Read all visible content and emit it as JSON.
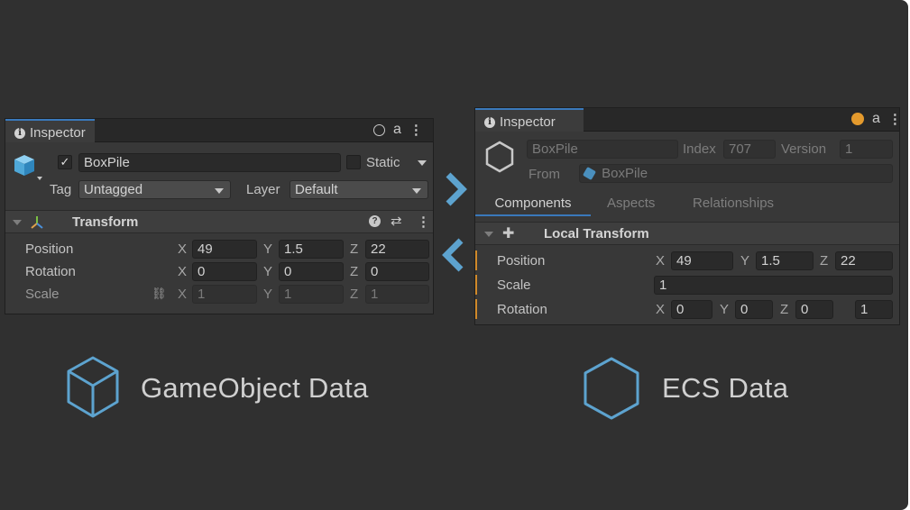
{
  "left_inspector": {
    "tab_label": "Inspector",
    "object_name": "BoxPile",
    "static_label": "Static",
    "tag_label": "Tag",
    "tag_value": "Untagged",
    "layer_label": "Layer",
    "layer_value": "Default",
    "transform_title": "Transform",
    "rows": [
      {
        "label": "Position",
        "x": "49",
        "y": "1.5",
        "z": "22"
      },
      {
        "label": "Rotation",
        "x": "0",
        "y": "0",
        "z": "0"
      },
      {
        "label": "Scale",
        "x": "1",
        "y": "1",
        "z": "1"
      }
    ]
  },
  "right_inspector": {
    "tab_label": "Inspector",
    "entity_name": "BoxPile",
    "index_label": "Index",
    "index_value": "707",
    "version_label": "Version",
    "version_value": "1",
    "from_label": "From",
    "from_value": "BoxPile",
    "tabs": [
      "Components",
      "Aspects",
      "Relationships"
    ],
    "section_title": "Local Transform",
    "position": {
      "label": "Position",
      "x": "49",
      "y": "1.5",
      "z": "22"
    },
    "scale": {
      "label": "Scale",
      "value": "1"
    },
    "rotation": {
      "label": "Rotation",
      "x": "0",
      "y": "0",
      "z": "0",
      "w": "1"
    }
  },
  "axes": {
    "x": "X",
    "y": "Y",
    "z": "Z"
  },
  "captions": {
    "gameobject": "GameObject Data",
    "ecs": "ECS Data"
  },
  "colors": {
    "background": "#303030",
    "accent_blue": "#5da3cf",
    "tab_highlight": "#3a79bb",
    "orange_status": "#e49a2d"
  }
}
